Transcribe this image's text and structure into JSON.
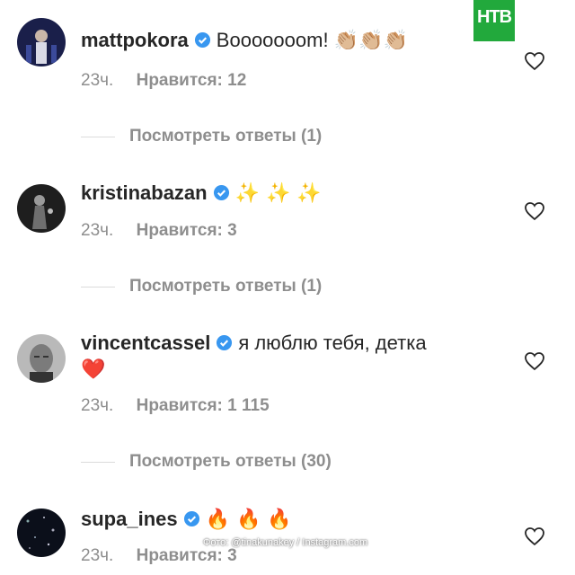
{
  "logo": {
    "text": "НТВ",
    "color": "#22a93c"
  },
  "watermark": "Фото: @tinakunakey / Instagram.com",
  "comments": [
    {
      "username": "mattpokora",
      "verified": true,
      "text": "Booooooom!",
      "emoji": "👏🏼👏🏼👏🏼",
      "time": "23ч.",
      "likes": "Нравится: 12",
      "replies": "Посмотреть ответы (1)"
    },
    {
      "username": "kristinabazan",
      "verified": true,
      "text": "",
      "emoji": "✨ ✨ ✨",
      "time": "23ч.",
      "likes": "Нравится: 3",
      "replies": "Посмотреть ответы (1)"
    },
    {
      "username": "vincentcassel",
      "verified": true,
      "text": "я люблю тебя, детка",
      "emoji": "❤️",
      "time": "23ч.",
      "likes": "Нравится: 1 115",
      "replies": "Посмотреть ответы (30)"
    },
    {
      "username": "supa_ines",
      "verified": true,
      "text": "",
      "emoji": "🔥 🔥 🔥",
      "time": "23ч.",
      "likes": "Нравится: 3",
      "replies": ""
    }
  ],
  "icons": {
    "verified": "verified-badge-icon",
    "like": "heart-outline-icon"
  },
  "colors": {
    "verified": "#3897f0",
    "meta": "#8e8e8e",
    "text": "#262626"
  }
}
